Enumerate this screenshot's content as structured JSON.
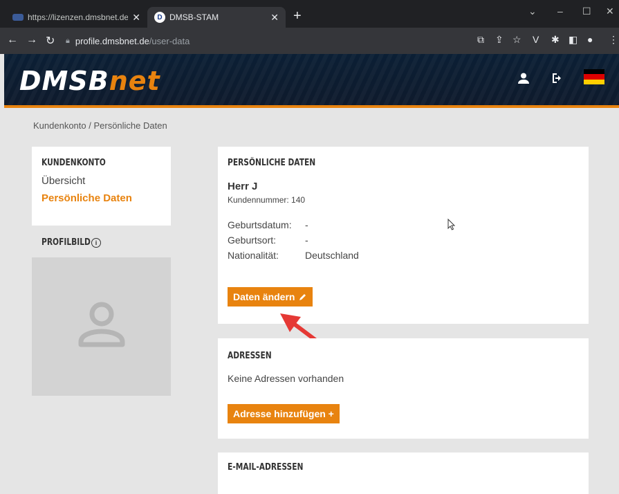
{
  "browser": {
    "tabs": [
      {
        "title": "https://lizenzen.dmsbnet.de/licen",
        "close": "✕"
      },
      {
        "title": "DMSB-STAM",
        "close": "✕"
      }
    ],
    "new_tab": "+",
    "url_host": "profile.dmsbnet.de",
    "url_path": "/user-data"
  },
  "site": {
    "logo_main": "DMSB",
    "logo_suffix": "net",
    "accent": "#e8830f",
    "header_bg": "#0e1a2c"
  },
  "breadcrumb": "Kundenkonto / Persönliche Daten",
  "sidebar": {
    "title": "KUNDENKONTO",
    "items": [
      {
        "label": "Übersicht",
        "active": false
      },
      {
        "label": "Persönliche Daten",
        "active": true
      }
    ],
    "profile_title": "PROFILBILD",
    "info_icon": "i"
  },
  "personal": {
    "title": "PERSÖNLICHE DATEN",
    "name": "Herr J",
    "customer_number": "Kundennummer: 140",
    "fields": [
      {
        "label": "Geburtsdatum:",
        "value": "-"
      },
      {
        "label": "Geburtsort:",
        "value": "-"
      },
      {
        "label": "Nationalität:",
        "value": "Deutschland"
      }
    ],
    "edit_button": "Daten ändern"
  },
  "addresses": {
    "title": "ADRESSEN",
    "empty_text": "Keine Adressen vorhanden",
    "add_button": "Adresse hinzufügen +"
  },
  "emails": {
    "title": "E-MAIL-ADRESSEN"
  }
}
